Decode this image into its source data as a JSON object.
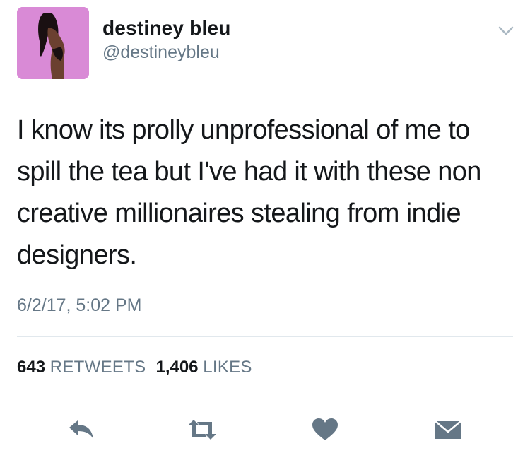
{
  "user": {
    "display_name": "destiney bleu",
    "handle": "@destineybleu"
  },
  "tweet": {
    "text": "I know its prolly unprofessional of me to spill the tea but I've had it with these non creative millionaires stealing from indie designers.",
    "timestamp": "6/2/17, 5:02 PM"
  },
  "stats": {
    "retweets_count": "643",
    "retweets_label": "RETWEETS",
    "likes_count": "1,406",
    "likes_label": "LIKES"
  },
  "actions": [
    {
      "icon": "reply-icon"
    },
    {
      "icon": "retweet-icon"
    },
    {
      "icon": "heart-icon"
    },
    {
      "icon": "envelope-icon"
    }
  ],
  "colors": {
    "icon": "#657786",
    "secondary_text": "#657786",
    "divider": "#e1e8ed",
    "avatar_bg": "#d98ad6"
  }
}
